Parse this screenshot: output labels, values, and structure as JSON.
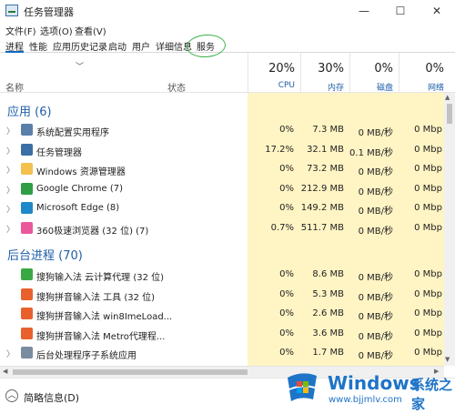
{
  "window": {
    "title": "任务管理器",
    "controls": [
      "—",
      "☐",
      "✕"
    ]
  },
  "menubar": [
    "文件(F)",
    "选项(O)",
    "查看(V)"
  ],
  "tabs": [
    "进程",
    "性能",
    "应用历史记录",
    "启动",
    "用户",
    "详细信息",
    "服务"
  ],
  "header": {
    "name_label": "名称",
    "status_label": "状态",
    "metrics": [
      {
        "pct": "20%",
        "label": "CPU"
      },
      {
        "pct": "30%",
        "label": "内存"
      },
      {
        "pct": "0%",
        "label": "磁盘"
      },
      {
        "pct": "0%",
        "label": "网络"
      }
    ]
  },
  "groups": {
    "apps": "应用 (6)",
    "background": "后台进程 (70)"
  },
  "rows": [
    {
      "name": "系统配置实用程序",
      "cpu": "0%",
      "mem": "7.3 MB",
      "disk": "0 MB/秒",
      "net": "0 Mbp",
      "icon": "settings-icon",
      "color": "#5b7fa8"
    },
    {
      "name": "任务管理器",
      "cpu": "17.2%",
      "mem": "32.1 MB",
      "disk": "0.1 MB/秒",
      "net": "0 Mbp",
      "icon": "task-manager-icon",
      "color": "#3a6ea5"
    },
    {
      "name": "Windows 资源管理器",
      "cpu": "0%",
      "mem": "73.2 MB",
      "disk": "0 MB/秒",
      "net": "0 Mbp",
      "icon": "folder-icon",
      "color": "#f2c14e"
    },
    {
      "name": "Google Chrome (7)",
      "cpu": "0%",
      "mem": "212.9 MB",
      "disk": "0 MB/秒",
      "net": "0 Mbp",
      "icon": "chrome-icon",
      "color": "#2f9e44"
    },
    {
      "name": "Microsoft Edge (8)",
      "cpu": "0%",
      "mem": "149.2 MB",
      "disk": "0 MB/秒",
      "net": "0 Mbp",
      "icon": "edge-icon",
      "color": "#1e88c8"
    },
    {
      "name": "360极速浏览器 (32 位) (7)",
      "cpu": "0.7%",
      "mem": "511.7 MB",
      "disk": "0 MB/秒",
      "net": "0 Mbp",
      "icon": "browser-360-icon",
      "color": "#e9589b"
    },
    {
      "name": "搜狗输入法 云计算代理 (32 位)",
      "cpu": "0%",
      "mem": "8.6 MB",
      "disk": "0 MB/秒",
      "net": "0 Mbp",
      "icon": "sogou-icon",
      "color": "#3aa845"
    },
    {
      "name": "搜狗拼音输入法 工具 (32 位)",
      "cpu": "0%",
      "mem": "5.3 MB",
      "disk": "0 MB/秒",
      "net": "0 Mbp",
      "icon": "sogou-icon",
      "color": "#e8612c"
    },
    {
      "name": "搜狗拼音输入法 win8ImeLoad...",
      "cpu": "0%",
      "mem": "2.6 MB",
      "disk": "0 MB/秒",
      "net": "0 Mbp",
      "icon": "sogou-icon",
      "color": "#e8612c"
    },
    {
      "name": "搜狗拼音输入法 Metro代理程...",
      "cpu": "0%",
      "mem": "3.6 MB",
      "disk": "0 MB/秒",
      "net": "0 Mbp",
      "icon": "sogou-icon",
      "color": "#e8612c"
    },
    {
      "name": "后台处理程序子系统应用",
      "cpu": "0%",
      "mem": "1.7 MB",
      "disk": "0 MB/秒",
      "net": "0 Mbp",
      "icon": "printer-icon",
      "color": "#7a8ca0"
    }
  ],
  "footer": {
    "label": "简略信息(D)"
  },
  "watermark": {
    "brand": "Windows",
    "suffix": "系统之家",
    "url": "www.bjjmlv.com"
  }
}
